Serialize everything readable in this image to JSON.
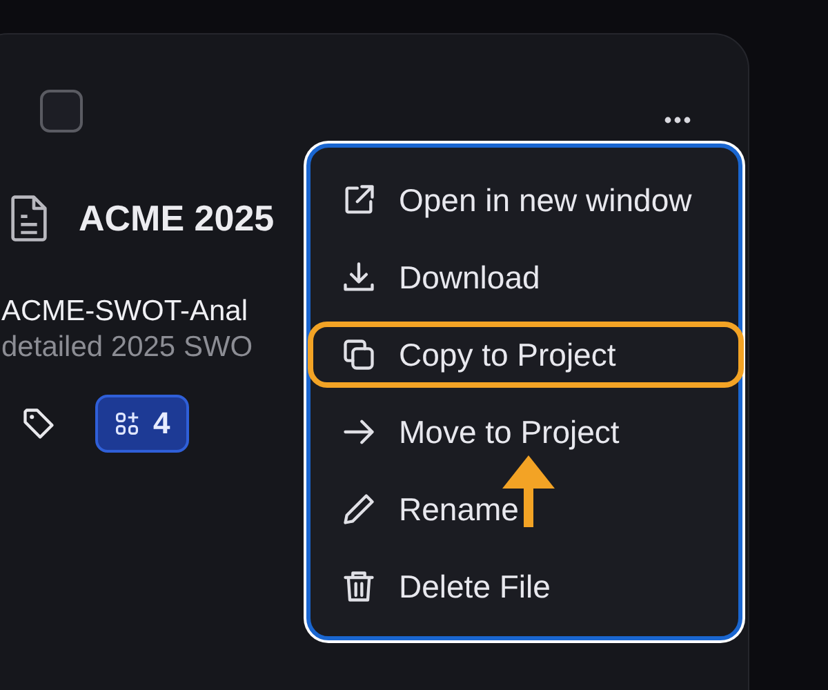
{
  "card": {
    "checkbox": {
      "checked": false
    },
    "title": "ACME 2025",
    "file_name": "ACME-SWOT-Anal",
    "description": "detailed 2025 SWO",
    "badge": "4"
  },
  "menu": {
    "items": [
      {
        "label": "Open in new window",
        "kind": "open-external",
        "highlighted": false
      },
      {
        "label": "Download",
        "kind": "download",
        "highlighted": false
      },
      {
        "label": "Copy to Project",
        "kind": "copy",
        "highlighted": true
      },
      {
        "label": "Move to Project",
        "kind": "move",
        "highlighted": false
      },
      {
        "label": "Rename",
        "kind": "rename",
        "highlighted": false
      },
      {
        "label": "Delete File",
        "kind": "delete",
        "highlighted": false
      }
    ]
  }
}
